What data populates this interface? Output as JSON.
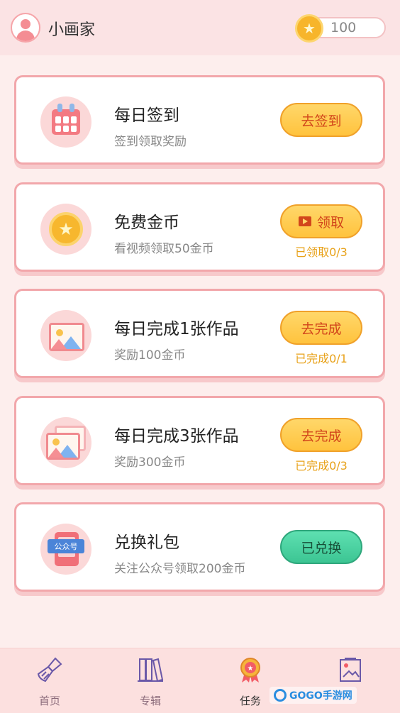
{
  "header": {
    "username": "小画家",
    "coins": "100"
  },
  "tasks": [
    {
      "title": "每日签到",
      "desc": "签到领取奖励",
      "button": "去签到",
      "status": ""
    },
    {
      "title": "免费金币",
      "desc": "看视频领取50金币",
      "button": "领取",
      "status": "已领取0/3"
    },
    {
      "title": "每日完成1张作品",
      "desc": "奖励100金币",
      "button": "去完成",
      "status": "已完成0/1"
    },
    {
      "title": "每日完成3张作品",
      "desc": "奖励300金币",
      "button": "去完成",
      "status": "已完成0/3"
    },
    {
      "title": "兑换礼包",
      "desc": "关注公众号领取200金币",
      "button": "已兑换",
      "status": "",
      "badge": "公众号"
    }
  ],
  "tabs": [
    {
      "label": "首页",
      "icon": "broom-icon"
    },
    {
      "label": "专辑",
      "icon": "books-icon"
    },
    {
      "label": "任务",
      "icon": "medal-icon",
      "active": true
    },
    {
      "label": "",
      "icon": "drawing-board-icon"
    }
  ],
  "watermark": "GOGO手游网",
  "colors": {
    "accent": "#f2a7ab",
    "button_yellow": "#ffc33e",
    "button_green": "#3cc593",
    "status_text": "#e8a21a"
  }
}
